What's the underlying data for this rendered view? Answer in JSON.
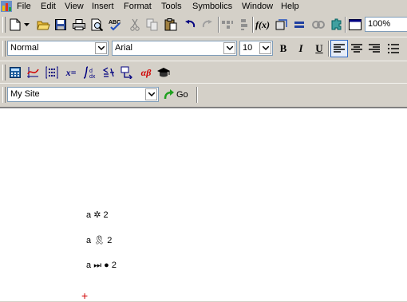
{
  "menubar": {
    "items": [
      "File",
      "Edit",
      "View",
      "Insert",
      "Format",
      "Tools",
      "Symbolics",
      "Window",
      "Help"
    ]
  },
  "standard_toolbar": {
    "buttons": [
      "new-document-icon",
      "open-folder-icon",
      "save-icon",
      "print-icon",
      "print-preview-icon",
      "spell-check-icon",
      "cut-icon",
      "copy-icon",
      "paste-icon",
      "undo-icon",
      "redo-icon",
      "align-across-icon",
      "align-down-icon",
      "insert-function-icon",
      "insert-unit-icon",
      "calculate-icon",
      "insert-hyperlink-icon",
      "component-icon",
      "resource-center-icon"
    ],
    "zoom": "100%"
  },
  "formatting_toolbar": {
    "style": "Normal",
    "font": "Arial",
    "size": "10",
    "bold": "B",
    "italic": "I",
    "underline": "U"
  },
  "math_toolbar": {
    "buttons": [
      "calculator-toolbar-icon",
      "graph-toolbar-icon",
      "matrix-toolbar-icon",
      "evaluation-toolbar-icon",
      "calculus-toolbar-icon",
      "boolean-toolbar-icon",
      "programming-toolbar-icon",
      "greek-toolbar-icon",
      "symbolic-toolbar-icon"
    ],
    "evaluation_label": "x=",
    "greek_label": "αβ"
  },
  "web_toolbar": {
    "address": "My Site",
    "go_label": "Go"
  },
  "worksheet": {
    "regions": [
      {
        "prefix": "a",
        "glyph": "✲",
        "suffix": "2"
      },
      {
        "prefix": "a",
        "glyph": "🎗",
        "suffix": "2"
      },
      {
        "prefix": "a",
        "glyph": "⏭ ●",
        "suffix": "2"
      }
    ],
    "cursor": "+"
  }
}
